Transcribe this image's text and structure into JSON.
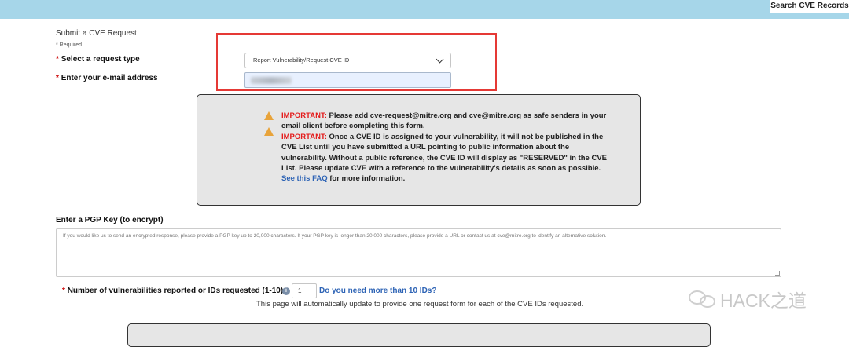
{
  "header": {
    "search_label": "Search CVE Records"
  },
  "form": {
    "title": "Submit a CVE Request",
    "required_note": "* Required",
    "required_star": "*",
    "request_type_label": "Select a request type",
    "request_type_value": "Report Vulnerability/Request CVE ID",
    "email_label": "Enter your e-mail address"
  },
  "notice": {
    "important_tag": "IMPORTANT:",
    "line1": "Please add cve-request@mitre.org and cve@mitre.org as safe senders in your email client before completing this form.",
    "line2": "Once a CVE ID is assigned to your vulnerability, it will not be published in the CVE List until you have submitted a URL pointing to public information about the vulnerability. Without a public reference, the CVE ID will display as \"RESERVED\" in the CVE List. Please update CVE with a reference to the vulnerability's details as soon as possible.",
    "faq_link": "See this FAQ",
    "tail": "for more information."
  },
  "pgp": {
    "label": "Enter a PGP Key (to encrypt)",
    "placeholder": "If you would like us to send an encrypted response, please provide a PGP key up to 20,000 characters. If your PGP key is longer than 20,000 characters, please provide a URL or contact us at cve@mitre.org to identify an alternative solution."
  },
  "vulns": {
    "label": "Number of vulnerabilities reported or IDs requested (1-10)",
    "info_glyph": "i",
    "value": "1",
    "more_link": "Do you need more than 10 IDs?",
    "auto_note": "This page will automatically update to provide one request form for each of the CVE IDs requested."
  },
  "watermark": {
    "text": "HACK之道"
  },
  "colors": {
    "accent_bar": "#a6d6e9",
    "important": "#e41b1b",
    "link": "#2d63b5",
    "highlight_box": "#e53935"
  }
}
